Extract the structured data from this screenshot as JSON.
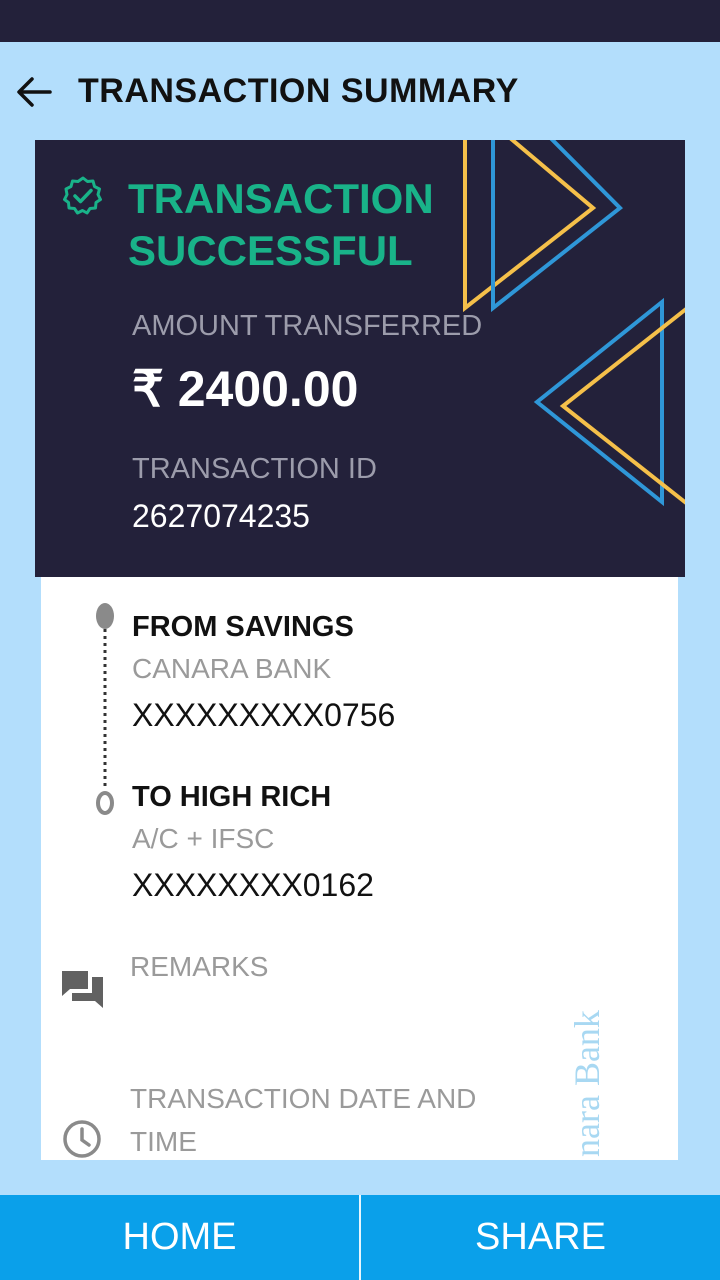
{
  "header": {
    "title": "TRANSACTION SUMMARY",
    "back_icon": "arrow-left-icon"
  },
  "transaction": {
    "status": "TRANSACTION SUCCESSFUL",
    "amount_label": "AMOUNT TRANSFERRED",
    "amount": "₹ 2400.00",
    "id_label": "TRANSACTION ID",
    "id": "2627074235"
  },
  "from": {
    "title": "FROM SAVINGS",
    "bank": "CANARA BANK",
    "account": "XXXXXXXXX0756"
  },
  "to": {
    "title": "TO HIGH RICH",
    "method": "A/C + IFSC",
    "account": "XXXXXXXX0162"
  },
  "remarks": {
    "label": "REMARKS"
  },
  "datetime": {
    "label": "TRANSACTION DATE AND TIME"
  },
  "watermark": "nara Bank",
  "bottom": {
    "home_label": "HOME",
    "share_label": "SHARE"
  },
  "colors": {
    "dark_navy": "#23213a",
    "success_green": "#19b389",
    "accent_yellow": "#f5c04a",
    "accent_blue": "#2f97d8",
    "button_blue": "#0aa0ea",
    "page_background": "#b3defc"
  }
}
